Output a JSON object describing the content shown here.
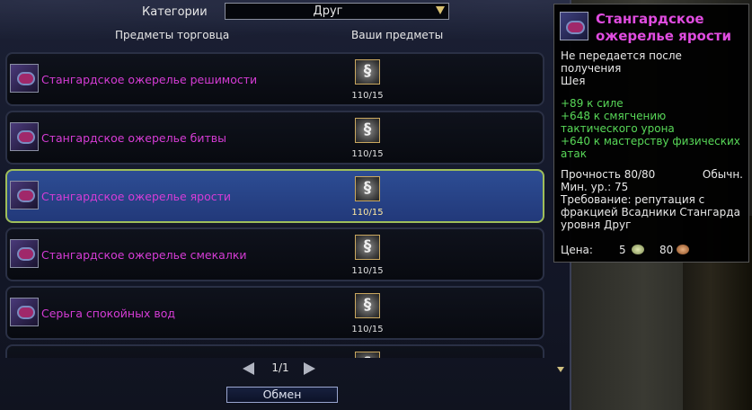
{
  "header": {
    "category_label": "Категории",
    "category_value": "Друг",
    "merchant_items_label": "Предметы торговца",
    "your_items_label": "Ваши предметы"
  },
  "items": [
    {
      "name": "Стангардское ожерелье решимости",
      "qty": "110/15",
      "selected": false
    },
    {
      "name": "Стангардское ожерелье битвы",
      "qty": "110/15",
      "selected": false
    },
    {
      "name": "Стангардское ожерелье ярости",
      "qty": "110/15",
      "selected": true
    },
    {
      "name": "Стангардское ожерелье смекалки",
      "qty": "110/15",
      "selected": false
    },
    {
      "name": "Серьга спокойных вод",
      "qty": "110/15",
      "selected": false
    }
  ],
  "pager": {
    "page": "1/1"
  },
  "exchange_button": "Обмен",
  "tooltip": {
    "title": "Стангардское ожерелье ярости",
    "bind_note_1": "Не передается после",
    "bind_note_2": "получения",
    "slot": "Шея",
    "stat_1": "+89 к силе",
    "stat_2a": "+648 к смягчению",
    "stat_2b": "тактического урона",
    "stat_3a": "+640 к мастерству физических",
    "stat_3b": "атак",
    "durability": "Прочность 80/80",
    "rarity": "Обычн.",
    "min_level": "Мин. ур.: 75",
    "req_1": "Требование: репутация с",
    "req_2": "фракцией Всадники Стангарда",
    "req_3": "уровня Друг",
    "price_label": "Цена:",
    "price_1": "5",
    "price_2": "80"
  },
  "colors": {
    "item_name": "#d63cd6",
    "stat_green": "#58d858",
    "selected_row": "#2d4d94",
    "selected_border": "#9fbe5a"
  },
  "icons": [
    "necklace-icon",
    "coin-token-icon",
    "arrow-left-icon",
    "arrow-right-icon",
    "dropdown-arrow-icon"
  ]
}
